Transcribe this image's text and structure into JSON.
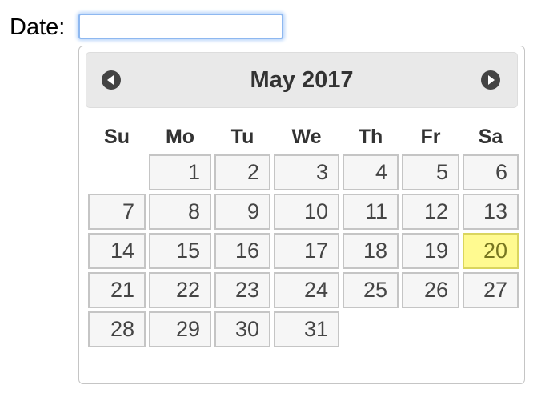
{
  "form": {
    "date_label": "Date:",
    "date_value": ""
  },
  "datepicker": {
    "title": "May 2017",
    "prev_icon": "chevron-left-icon",
    "next_icon": "chevron-right-icon",
    "weekdays": [
      "Su",
      "Mo",
      "Tu",
      "We",
      "Th",
      "Fr",
      "Sa"
    ],
    "weeks": [
      [
        "",
        "1",
        "2",
        "3",
        "4",
        "5",
        "6"
      ],
      [
        "7",
        "8",
        "9",
        "10",
        "11",
        "12",
        "13"
      ],
      [
        "14",
        "15",
        "16",
        "17",
        "18",
        "19",
        "20"
      ],
      [
        "21",
        "22",
        "23",
        "24",
        "25",
        "26",
        "27"
      ],
      [
        "28",
        "29",
        "30",
        "31",
        "",
        "",
        ""
      ]
    ],
    "highlighted_day": "20",
    "colors": {
      "highlight_bg": "#fffa90",
      "highlight_border": "#dad55e",
      "input_focus": "#8eb8f0"
    }
  }
}
